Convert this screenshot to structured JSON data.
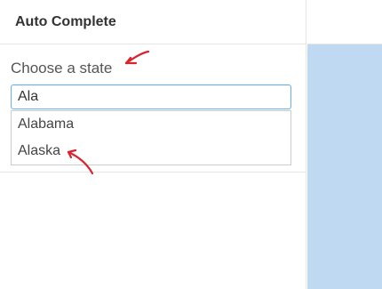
{
  "panel": {
    "title": "Auto Complete"
  },
  "form": {
    "label": "Choose a state",
    "input_value": "Ala"
  },
  "suggestions": [
    {
      "label": "Alabama"
    },
    {
      "label": "Alaska"
    }
  ],
  "colors": {
    "side_area": "#bfd9f2",
    "annotation": "#d9232d",
    "input_focus_border": "#66afe9"
  },
  "annotations": {
    "label_arrow_icon": "red-arrow-icon",
    "item_arrow_icon": "red-arrow-icon"
  }
}
